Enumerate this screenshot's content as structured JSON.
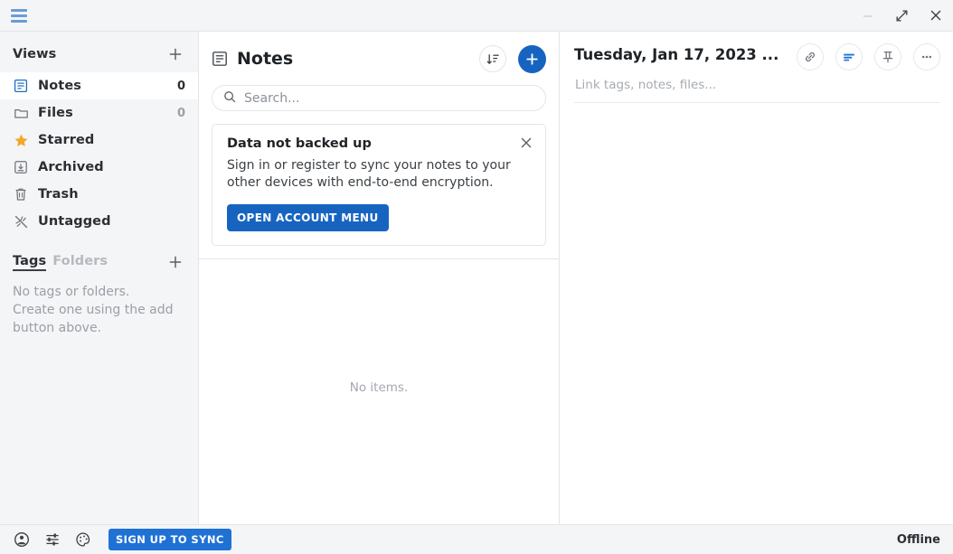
{
  "window": {
    "menu_icon": "hamburger-icon",
    "controls": [
      {
        "name": "minimize",
        "icon": "minimize-icon"
      },
      {
        "name": "maximize",
        "icon": "expand-diagonal-icon"
      },
      {
        "name": "close",
        "icon": "close-icon"
      }
    ]
  },
  "sidebar": {
    "views_section": {
      "title": "Views",
      "add_label": "+"
    },
    "items": [
      {
        "label": "Notes",
        "count": "0",
        "icon": "note-document-icon",
        "selected": true,
        "count_strong": true
      },
      {
        "label": "Files",
        "count": "0",
        "icon": "folder-icon",
        "selected": false,
        "count_strong": false
      },
      {
        "label": "Starred",
        "count": "",
        "icon": "star-icon",
        "selected": false,
        "count_strong": false
      },
      {
        "label": "Archived",
        "count": "",
        "icon": "archive-box-icon",
        "selected": false,
        "count_strong": false
      },
      {
        "label": "Trash",
        "count": "",
        "icon": "trash-icon",
        "selected": false,
        "count_strong": false
      },
      {
        "label": "Untagged",
        "count": "",
        "icon": "untagged-icon",
        "selected": false,
        "count_strong": false
      }
    ],
    "tags_section": {
      "tags_tab": "Tags",
      "folders_tab": "Folders",
      "add_label": "+",
      "empty_text": "No tags or folders. Create one using the add button above."
    }
  },
  "notes_panel": {
    "icon": "note-document-icon",
    "title": "Notes",
    "sort_icon": "sort-descending-icon",
    "add_icon": "plus-icon",
    "search": {
      "placeholder": "Search...",
      "value": "",
      "icon": "search-icon"
    },
    "banner": {
      "title": "Data not backed up",
      "text": "Sign in or register to sync your notes to your other devices with end-to-end encryption.",
      "button_label": "OPEN ACCOUNT MENU",
      "close_icon": "close-icon"
    },
    "empty_state": "No items."
  },
  "editor_panel": {
    "title": "Tuesday, Jan 17, 2023 ...",
    "subtitle": "Link tags, notes, files...",
    "actions": [
      {
        "name": "link-button",
        "icon": "link-chain-icon"
      },
      {
        "name": "format-button",
        "icon": "text-lines-icon",
        "accent": true
      },
      {
        "name": "pin-button",
        "icon": "pin-icon"
      },
      {
        "name": "more-button",
        "icon": "ellipsis-icon"
      }
    ]
  },
  "statusbar": {
    "icons": [
      {
        "name": "account-button",
        "icon": "person-circle-icon"
      },
      {
        "name": "preferences-button",
        "icon": "sliders-icon"
      },
      {
        "name": "theme-button",
        "icon": "palette-icon"
      }
    ],
    "sync_button_label": "SIGN UP TO SYNC",
    "connection_status": "Offline"
  },
  "colors": {
    "accent_blue": "#1764c0",
    "sync_blue": "#1f72d4",
    "hamburger_blue": "#6b9bd8",
    "sidebar_bg": "#f4f5f7",
    "panel_bg": "#ffffff",
    "border": "#e3e5e8",
    "text_primary": "#1f2327",
    "text_muted": "#9aa0a6",
    "star_yellow": "#f0a92b"
  }
}
